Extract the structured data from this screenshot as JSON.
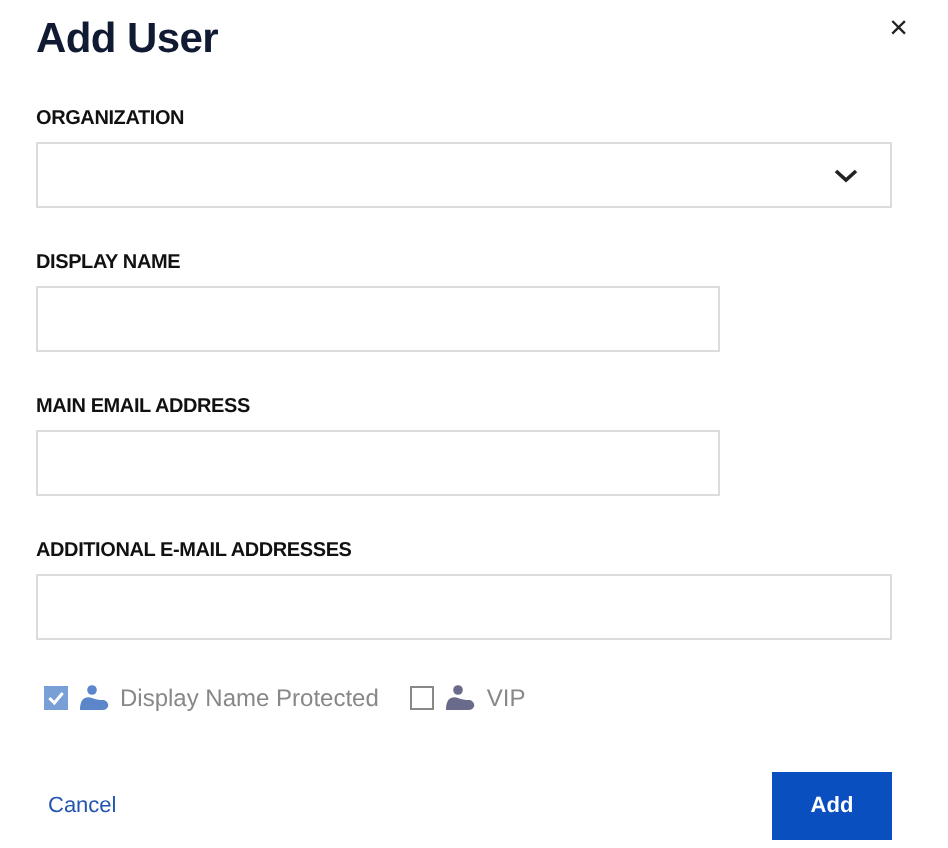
{
  "dialog": {
    "title": "Add User",
    "close": "×"
  },
  "fields": [
    {
      "kind": "select",
      "label": "ORGANIZATION"
    },
    {
      "kind": "text",
      "label": "DISPLAY NAME"
    },
    {
      "kind": "text",
      "label": "MAIN EMAIL ADDRESS"
    },
    {
      "kind": "text",
      "label": "ADDITIONAL E-MAIL ADDRESSES"
    }
  ],
  "options": [
    {
      "label": "Display Name Protected",
      "checked": true
    },
    {
      "label": "VIP",
      "checked": false
    }
  ],
  "buttons": {
    "cancel": "Cancel",
    "submit": "Add"
  }
}
